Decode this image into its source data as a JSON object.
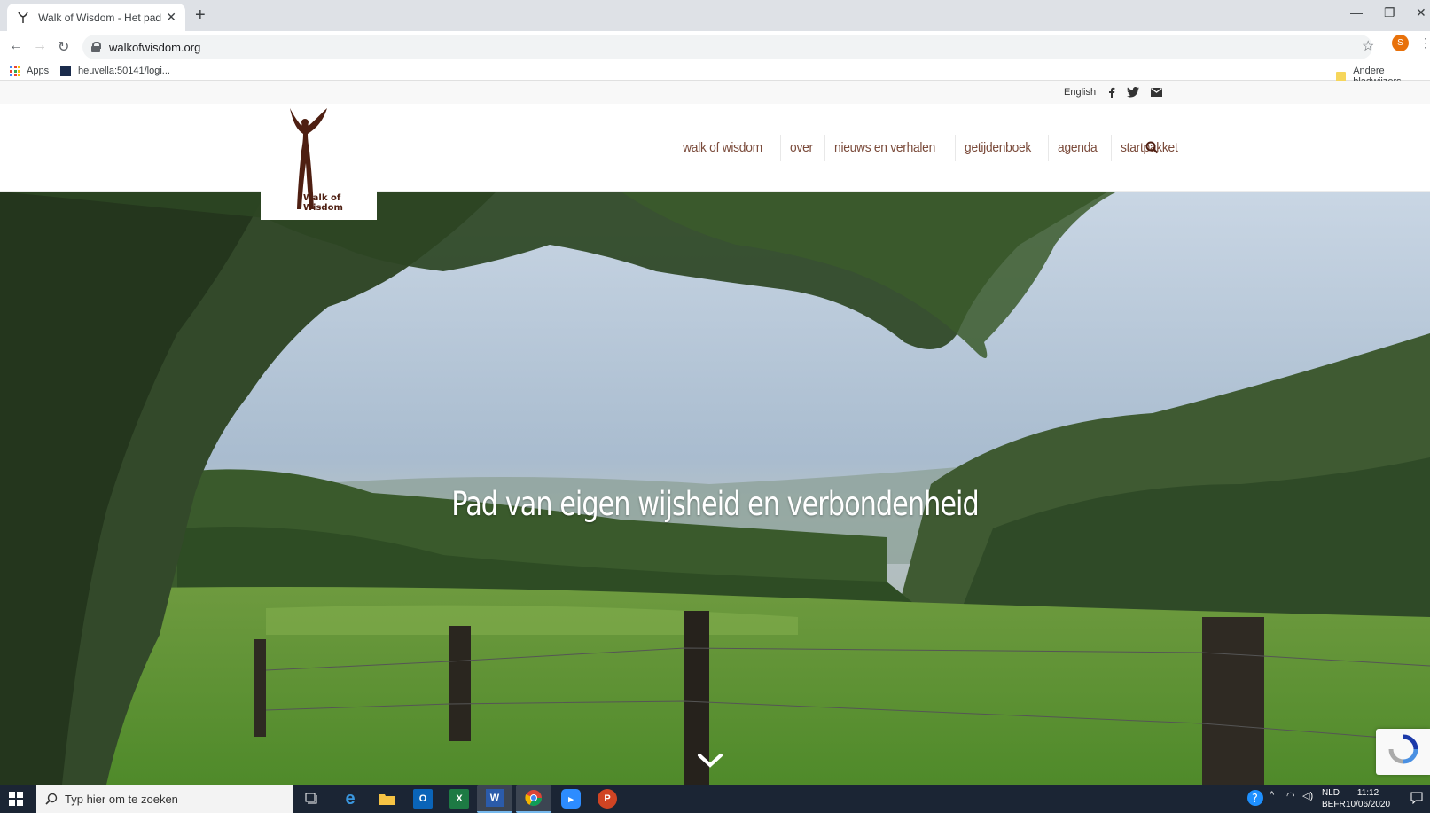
{
  "browser": {
    "tab_title": "Walk of Wisdom - Het pad van je",
    "new_tab_symbol": "+",
    "url": "walkofwisdom.org",
    "profile_initial": "S",
    "bookmarks": {
      "apps_label": "Apps",
      "item1_label": "heuvella:50141/logi...",
      "other_label": "Andere bladwijzers"
    }
  },
  "site": {
    "topbar": {
      "language_link": "English"
    },
    "logo_text": "Walk of Wisdom",
    "nav": [
      "walk of wisdom",
      "over",
      "nieuws en verhalen",
      "getijdenboek",
      "agenda",
      "startpakket"
    ],
    "hero_title": "Pad van eigen wijsheid en verbondenheid",
    "colors": {
      "brand_brown": "#4e1f12",
      "nav_text": "#7a4a3a"
    }
  },
  "taskbar": {
    "search_placeholder": "Typ hier om te zoeken",
    "lang_top": "NLD",
    "lang_bottom": "BEFR",
    "time": "11:12",
    "date": "10/06/2020"
  }
}
